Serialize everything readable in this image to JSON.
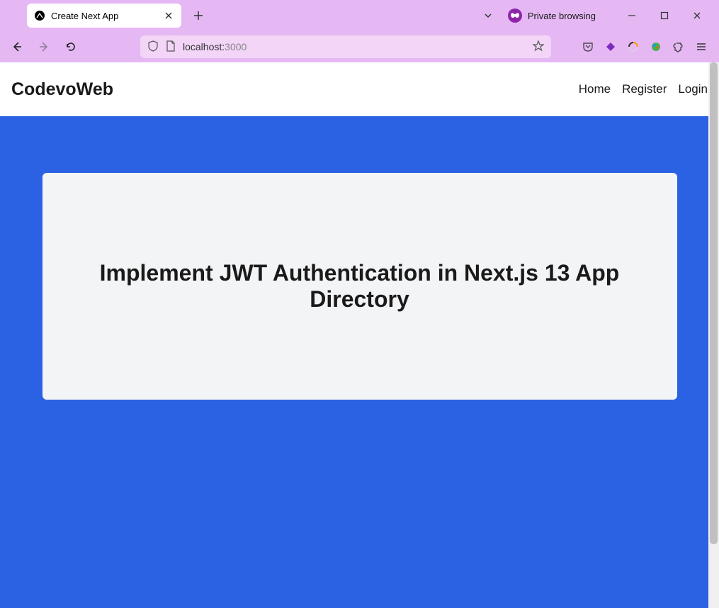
{
  "browser": {
    "tab_title": "Create Next App",
    "private_label": "Private browsing",
    "url_host": "localhost:",
    "url_port": "3000"
  },
  "site": {
    "logo": "CodevoWeb",
    "nav": {
      "home": "Home",
      "register": "Register",
      "login": "Login"
    }
  },
  "main": {
    "heading": "Implement JWT Authentication in Next.js 13 App Directory"
  }
}
